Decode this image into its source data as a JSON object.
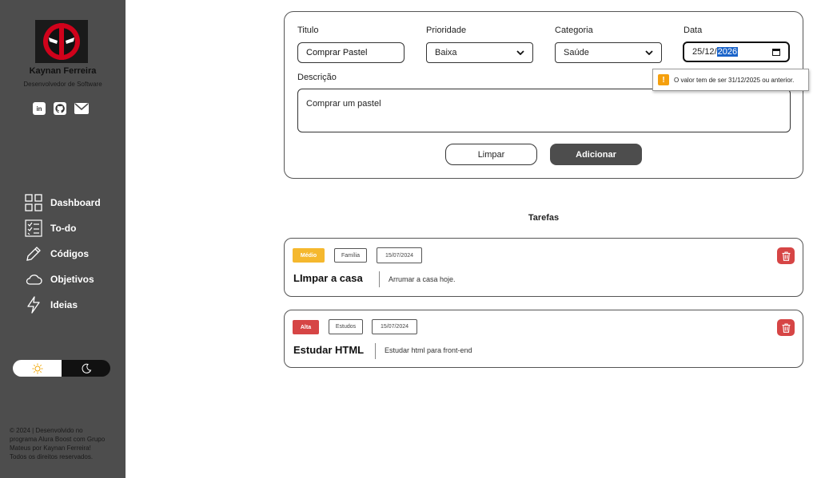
{
  "sidebar": {
    "profile": {
      "name": "Kaynan Ferreira",
      "role": "Desenvolvedor de Software",
      "avatar_icon": "deadpool-logo-icon"
    },
    "social": [
      {
        "icon": "linkedin-icon",
        "text": "in"
      },
      {
        "icon": "github-icon"
      },
      {
        "icon": "mail-icon"
      }
    ],
    "nav": [
      {
        "label": "Dashboard",
        "icon": "grid-icon"
      },
      {
        "label": "To-do",
        "icon": "checklist-icon"
      },
      {
        "label": "Códigos",
        "icon": "pencil-icon"
      },
      {
        "label": "Objetivos",
        "icon": "cloud-icon"
      },
      {
        "label": "Ideias",
        "icon": "lightning-icon"
      }
    ],
    "theme": {
      "light_icon": "sun-icon",
      "dark_icon": "moon-icon",
      "selected": "dark"
    },
    "footer": "© 2024 | Desenvolvido no programa Alura Boost com Grupo Mateus por Kaynan Ferreira! Todos os direitos reservados."
  },
  "form": {
    "title_label": "Titulo",
    "title_value": "Comprar Pastel",
    "priority_label": "Prioridade",
    "priority_value": "Baixa",
    "category_label": "Categoria",
    "category_value": "Saúde",
    "date_label": "Data",
    "date_day": "25",
    "date_month": "12",
    "date_year": "2026",
    "description_label": "Descrição",
    "description_value": "Comprar um pastel",
    "clear_label": "Limpar",
    "add_label": "Adicionar",
    "validation_message": "O valor tem de ser 31/12/2025 ou anterior."
  },
  "tasks": {
    "title": "Tarefas",
    "items": [
      {
        "priority": "Médio",
        "priority_color": "#f5b82e",
        "category": "Família",
        "date": "15/07/2024",
        "title": "LImpar a casa",
        "description": "Arrumar a casa hoje."
      },
      {
        "priority": "Alta",
        "priority_color": "#d64545",
        "category": "Estudos",
        "date": "15/07/2024",
        "title": "Estudar HTML",
        "description": "Estudar html para front-end"
      }
    ]
  }
}
